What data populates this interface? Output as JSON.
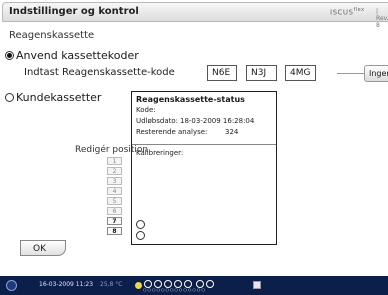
{
  "header": {
    "title": "Indstillinger og kontrol",
    "logo": "ISCUS",
    "logo_sup": "flex",
    "logo_ver": "| Rev. 8"
  },
  "section": {
    "title": "Reagenskassette"
  },
  "option_anvend": {
    "label": "Anvend kassettekoder",
    "selected": true,
    "code_prompt": "Indtast Reagenskassette-kode",
    "codes": [
      "N6E",
      "N3J",
      "4MG"
    ],
    "no_code_button": "Ingen kode"
  },
  "option_kunde": {
    "label": "Kundekassetter",
    "selected": false
  },
  "status": {
    "title": "Reagenskassette-status",
    "kode_label": "Kode:",
    "udlob_label": "Udløbsdato:",
    "udlob_value": "18-03-2009 16:28:04",
    "rest_label": "Resterende analyse:",
    "rest_value": "324",
    "kalib_label": "Kalibreringer:"
  },
  "positions": {
    "label": "Redigér position",
    "items": [
      "1",
      "2",
      "3",
      "4",
      "5",
      "6",
      "7",
      "8"
    ],
    "active": [
      "7",
      "8"
    ]
  },
  "ok_button": "OK",
  "taskbar": {
    "datetime": "16-03-2009 11:23",
    "temperature": "25,8 °C"
  },
  "colors": {
    "taskbar": "#0c1f4b",
    "status_lamp": "#f0d64a"
  }
}
